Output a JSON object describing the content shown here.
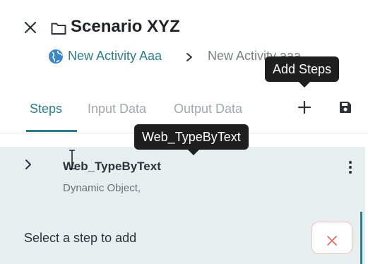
{
  "header": {
    "title": "Scenario XYZ",
    "breadcrumb": {
      "activity": "New Activity Aaa",
      "current": "New Activity aaa"
    }
  },
  "tooltips": {
    "add_steps": "Add Steps",
    "step": "Web_TypeByText"
  },
  "tabs": [
    {
      "label": "Steps",
      "active": true
    },
    {
      "label": "Input Data",
      "active": false
    },
    {
      "label": "Output Data",
      "active": false
    }
  ],
  "step": {
    "name": "Web_TypeByText",
    "subtitle": "Dynamic Object,"
  },
  "hint": "Select a step to add",
  "colors": {
    "accent": "#2a7e8a",
    "panel": "#e6eef0",
    "tooltip": "#1f1f1f",
    "danger": "#e5655b"
  },
  "icons": [
    "close-icon",
    "folder-icon",
    "globe-icon",
    "chevron-right-icon",
    "plus-icon",
    "save-icon",
    "kebab-menu-icon",
    "text-cursor-icon"
  ]
}
